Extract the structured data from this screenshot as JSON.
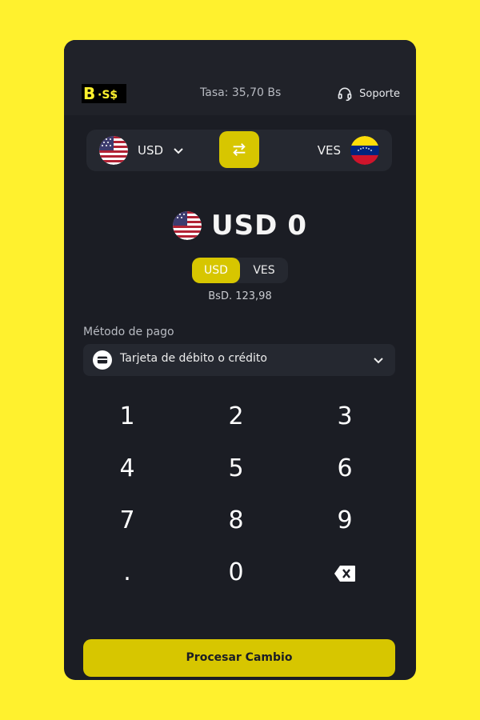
{
  "header": {
    "logo_text": "B·S$",
    "rate": "Tasa: 35,70 Bs",
    "support": "Soporte"
  },
  "selector": {
    "from_code": "USD",
    "to_code": "VES"
  },
  "amount": {
    "currency": "USD",
    "value": "0"
  },
  "toggle": {
    "options": [
      "USD",
      "VES"
    ],
    "selected": "USD"
  },
  "converted": "BsD. 123,98",
  "payment": {
    "label": "Método de pago",
    "selected": "Tarjeta de débito o crédito"
  },
  "keypad": {
    "keys": [
      "1",
      "2",
      "3",
      "4",
      "5",
      "6",
      "7",
      "8",
      "9",
      ".",
      "0"
    ],
    "delete_icon": "backspace-icon"
  },
  "action": {
    "process": "Procesar Cambio"
  },
  "colors": {
    "background": "#FFF12E",
    "panel": "#1B1D24",
    "accent": "#D7C600"
  }
}
